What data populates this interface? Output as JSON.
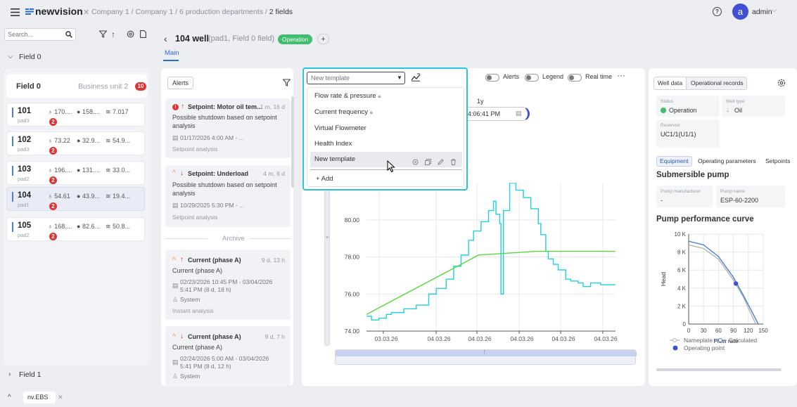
{
  "topbar": {
    "brand": "newvision",
    "breadcrumb": [
      "Company 1",
      "Company 1",
      "6 production departments",
      "2 fields"
    ],
    "user_initial": "a",
    "user_name": "admin"
  },
  "sidebar": {
    "search_placeholder": "Search...",
    "field0_label": "Field 0",
    "field1_label": "Field 1",
    "card_title": "Field 0",
    "card_unit": "Business unit 2",
    "card_count": "10",
    "wells": [
      {
        "id": "101",
        "pad": "pad3",
        "v1": "170....",
        "v2": "158....",
        "v3": "7.017",
        "alerts": "2"
      },
      {
        "id": "102",
        "pad": "pad3",
        "v1": "73.22",
        "v2": "32.9...",
        "v3": "54.9...",
        "alerts": "2"
      },
      {
        "id": "103",
        "pad": "pad2",
        "v1": "196....",
        "v2": "131....",
        "v3": "33.0...",
        "alerts": "2"
      },
      {
        "id": "104",
        "pad": "pad1",
        "v1": "54.61",
        "v2": "43.9...",
        "v3": "19.4...",
        "alerts": "2"
      },
      {
        "id": "105",
        "pad": "pad2",
        "v1": "168....",
        "v2": "82.6...",
        "v3": "50.8...",
        "alerts": "2"
      }
    ]
  },
  "header": {
    "title": "104 well",
    "subtitle": "(pad1, Field 0 field)",
    "status": "Operation",
    "tab_main": "Main"
  },
  "alerts": {
    "button": "Alerts",
    "archive_label": "Archive",
    "items": [
      {
        "title": "Setpoint: Motor oil tem...",
        "time": "1 m, 16 d",
        "l1": "Possible shutdown based on setpoint",
        "l2": "analysis",
        "date": "01/17/2026 4:00 AM - ...",
        "kind": "Setpoint analysis"
      },
      {
        "title": "Setpoint: Underload",
        "time": "4 m, 6 d",
        "l1": "Possible shutdown based on setpoint",
        "l2": "analysis",
        "date": "10/29/2025 5:30 PM - ...",
        "kind": "Setpoint analysis"
      },
      {
        "title": "Current (phase A)",
        "time": "9 d, 13 h",
        "l1": "Current (phase A)",
        "date": "02/23/2026 10:45 PM - 03/04/2026",
        "date2": "5:41 PM  (8 d, 18 h)",
        "user": "System",
        "kind": "Instant analysis"
      },
      {
        "title": "Current (phase A)",
        "time": "9 d, 7 h",
        "l1": "Current (phase A)",
        "date": "02/24/2026 5:00 AM - 03/04/2026",
        "date2": "5:41 PM  (8 d, 12 h)",
        "user": "System"
      }
    ]
  },
  "chart_toolbar": {
    "template_placeholder": "New template",
    "alerts": "Alerts",
    "legend": "Legend",
    "realtime": "Real time",
    "range_label": "1y",
    "time_value": "4:06:41 PM"
  },
  "template_menu": {
    "items": [
      "Flow rate & pressure",
      "Current frequency",
      "Virtual Flowmeter",
      "Health Index",
      "New template"
    ],
    "add_label": "+ Add"
  },
  "right_panel": {
    "tab_well": "Well data",
    "tab_records": "Operational records",
    "status_label": "Status",
    "status_value": "Operation",
    "welltype_label": "Well type",
    "welltype_value": "Oil",
    "reservoir_label": "Reservoir",
    "reservoir_value": "UC1/1(U1/1)",
    "subtabs": [
      "Equipment",
      "Operating parameters",
      "Setpoints"
    ],
    "section_title": "Submersible pump",
    "manufacturer_label": "Pump manufacturer",
    "manufacturer_value": "-",
    "pumpname_label": "Pump name",
    "pumpname_value": "ESP-60-2200",
    "curve_title": "Pump performance curve"
  },
  "bottom": {
    "tab_label": "nv.EBS"
  },
  "colors": {
    "accent": "#2a6dd8",
    "status_green": "#3dbf6e",
    "series_cyan": "#1fd0df",
    "series_green": "#56d93a",
    "alert_red": "#e03434",
    "curve_blue": "#4a80d6"
  },
  "chart_data": [
    {
      "type": "line",
      "ylim": [
        74,
        82
      ],
      "yticks": [
        "74.00",
        "76.00",
        "78.00",
        "80.00"
      ],
      "xticks": [
        "03.03.26",
        "04.03.26",
        "04.03.26",
        "04.03.26",
        "04.03.26",
        "04.03.26"
      ],
      "series": [
        {
          "color": "#1fd0df",
          "x": [
            0,
            0.02,
            0.05,
            0.08,
            0.1,
            0.15,
            0.2,
            0.25,
            0.28,
            0.32,
            0.35,
            0.38,
            0.41,
            0.43,
            0.46,
            0.49,
            0.51,
            0.52,
            0.535,
            0.54,
            0.55,
            0.575,
            0.6,
            0.63,
            0.66,
            0.69,
            0.7,
            0.72,
            0.73,
            0.75,
            0.77,
            0.8,
            0.82,
            0.85,
            0.87,
            0.9,
            0.94,
            0.97,
            1.0
          ],
          "y": [
            74.8,
            74.6,
            74.7,
            74.9,
            75.0,
            75.2,
            75.4,
            76.0,
            76.3,
            76.8,
            77.5,
            78.1,
            78.9,
            79.4,
            79.9,
            80.5,
            81.0,
            80.3,
            79.8,
            76.0,
            80.5,
            82.0,
            81.6,
            81.2,
            80.6,
            79.8,
            79.2,
            78.3,
            77.9,
            77.6,
            77.3,
            76.8,
            76.7,
            76.6,
            76.4,
            76.6,
            76.5,
            76.5,
            76.5
          ]
        },
        {
          "color": "#56d93a",
          "x": [
            0,
            0.45,
            0.68,
            1.0
          ],
          "y": [
            74.9,
            78.1,
            78.3,
            78.3
          ]
        }
      ]
    },
    {
      "type": "line",
      "xlabel": "Flow rate",
      "ylabel": "Head",
      "xlim": [
        0,
        150
      ],
      "ylim": [
        0,
        10000
      ],
      "xticks": [
        "0",
        "30",
        "60",
        "90",
        "120",
        "150"
      ],
      "yticks": [
        "0",
        "2 K",
        "4 K",
        "6 K",
        "8 K",
        "10 K"
      ],
      "legend": [
        "Nameplate",
        "Calculated",
        "Operating point"
      ],
      "series": [
        {
          "name": "Nameplate",
          "color": "#b3b3b3",
          "x": [
            0,
            30,
            60,
            90,
            110,
            125,
            135
          ],
          "y": [
            8800,
            8400,
            7200,
            4900,
            3000,
            1200,
            0
          ]
        },
        {
          "name": "Calculated",
          "color": "#4a80d6",
          "x": [
            0,
            30,
            60,
            90,
            110,
            128,
            140
          ],
          "y": [
            9200,
            8800,
            7500,
            5200,
            3200,
            1300,
            0
          ]
        },
        {
          "name": "Operating point",
          "color": "#3f4fd6",
          "x": [
            95
          ],
          "y": [
            4500
          ]
        }
      ]
    }
  ]
}
